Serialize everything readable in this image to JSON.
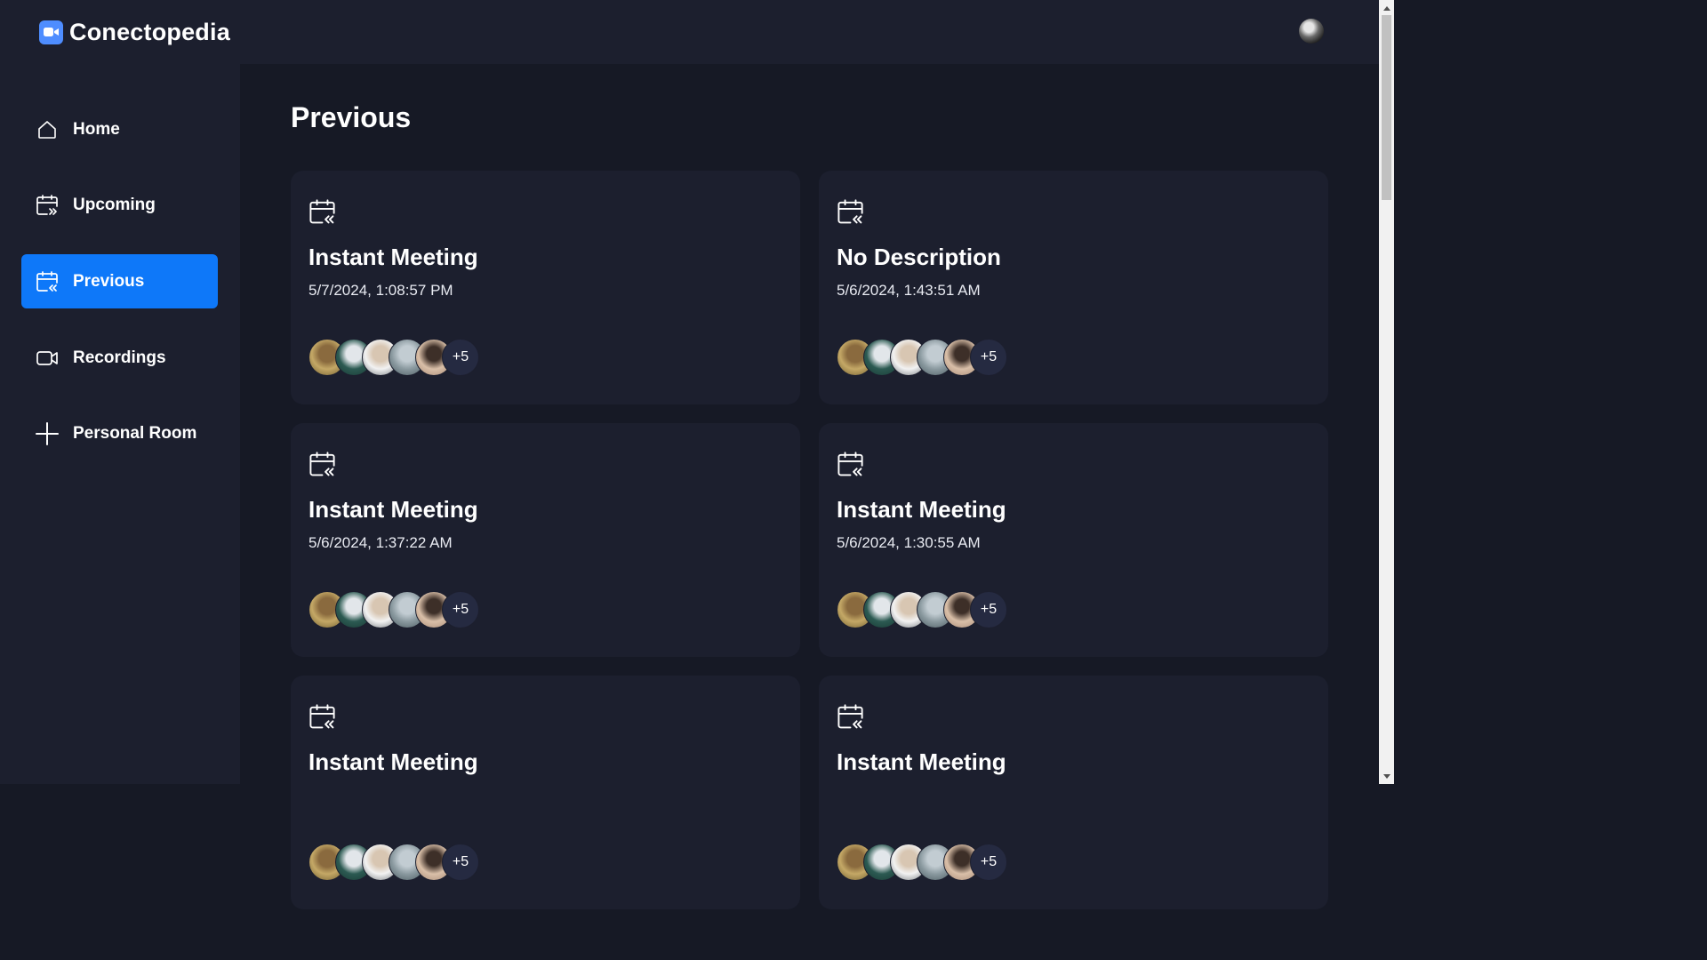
{
  "app": {
    "name": "Conectopedia"
  },
  "sidebar": {
    "items": [
      {
        "label": "Home",
        "icon": "home-icon",
        "active": false
      },
      {
        "label": "Upcoming",
        "icon": "calendar-upcoming-icon",
        "active": false
      },
      {
        "label": "Previous",
        "icon": "calendar-previous-icon",
        "active": true
      },
      {
        "label": "Recordings",
        "icon": "video-camera-icon",
        "active": false
      },
      {
        "label": "Personal Room",
        "icon": "plus-icon",
        "active": false
      }
    ]
  },
  "main": {
    "title": "Previous",
    "cards": [
      {
        "title": "Instant Meeting",
        "date": "5/7/2024, 1:08:57 PM",
        "more": "+5"
      },
      {
        "title": "No Description",
        "date": "5/6/2024, 1:43:51 AM",
        "more": "+5"
      },
      {
        "title": "Instant Meeting",
        "date": "5/6/2024, 1:37:22 AM",
        "more": "+5"
      },
      {
        "title": "Instant Meeting",
        "date": "5/6/2024, 1:30:55 AM",
        "more": "+5"
      },
      {
        "title": "Instant Meeting",
        "date": "",
        "more": "+5"
      },
      {
        "title": "Instant Meeting",
        "date": "",
        "more": "+5"
      }
    ]
  },
  "colors": {
    "background": "#161925",
    "panel": "#1c1f2e",
    "accent": "#0e78f9",
    "avatar_more": "#252a41"
  }
}
